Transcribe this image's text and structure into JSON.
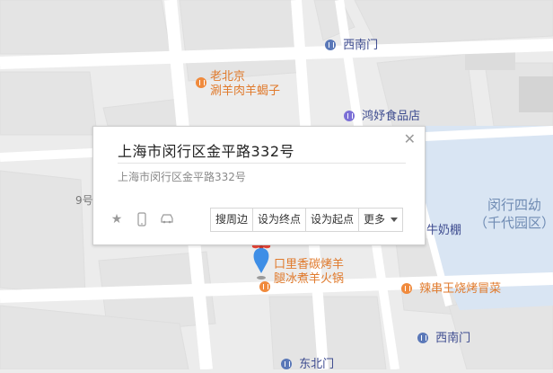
{
  "popup": {
    "title": "上海市闵行区金平路332号",
    "address": "上海市闵行区金平路332号",
    "close_icon": "close-icon",
    "buttons": {
      "nearby": "搜周边",
      "set_end": "设为终点",
      "set_start": "设为起点",
      "more": "更多"
    },
    "tool_icons": [
      "star-icon",
      "phone-icon",
      "car-icon"
    ]
  },
  "map": {
    "pois": {
      "laobeijing": {
        "line1": "老北京",
        "line2": "涮羊肉羊蝎子"
      },
      "hongyu": "鸿妤食品店",
      "xinanmen_top": "西南门",
      "xinanmen_bottom": "西南门",
      "niunaipeng": "牛奶棚",
      "lachuanwang": "辣串王烧烤冒菜",
      "kouli": {
        "line1": "口里香碳烤羊",
        "line2": "腿冰煮羊火锅"
      },
      "dongbeimen": "东北门"
    },
    "area": {
      "line1": "闵行四幼",
      "line2": "（千代园区）"
    },
    "building_number": "9号"
  },
  "colors": {
    "road": "#ffffff",
    "block": "#e6e6e6",
    "water": "#d9e5f3",
    "poi_orange": "#e07a2c",
    "poi_blue": "#3d4b8f",
    "marker_blue": "#3e8ee6",
    "marker_red": "#e8463a"
  }
}
